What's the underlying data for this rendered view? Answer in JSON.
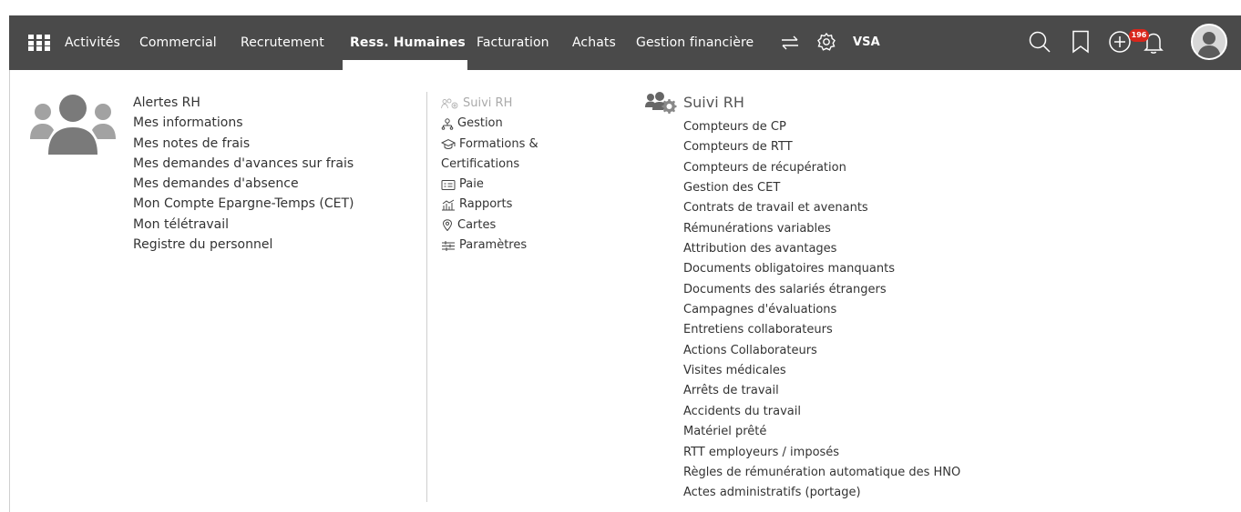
{
  "topnav": {
    "items": [
      "Activités",
      "Commercial",
      "Recrutement",
      "Ress. Humaines",
      "Facturation",
      "Achats",
      "Gestion financière"
    ],
    "active": "Ress. Humaines",
    "vsa_label": "VSA",
    "notifications_count": "196",
    "icons": [
      "apps-grid-icon",
      "swap-arrows-icon",
      "gear-icon",
      "search-icon",
      "bookmark-icon",
      "plus-circle-icon",
      "bell-icon",
      "user-avatar"
    ]
  },
  "personal_menu": {
    "items": [
      "Alertes RH",
      "Mes informations",
      "Mes notes de frais",
      "Mes demandes d'avances sur frais",
      "Mes demandes d'absence",
      "Mon Compte Epargne-Temps (CET)",
      "Mon télétravail",
      "Registre du personnel"
    ]
  },
  "modules_menu": {
    "items": [
      {
        "label": "Suivi RH",
        "icon": "users-gear-icon",
        "muted": true
      },
      {
        "label": "Gestion",
        "icon": "org-chart-icon"
      },
      {
        "label": "Formations &",
        "icon": "graduation-cap-icon"
      },
      {
        "label": "Certifications",
        "icon": ""
      },
      {
        "label": "Paie",
        "icon": "payslip-icon"
      },
      {
        "label": "Rapports",
        "icon": "report-chart-icon"
      },
      {
        "label": "Cartes",
        "icon": "map-pin-icon"
      },
      {
        "label": "Paramètres",
        "icon": "sliders-icon"
      }
    ]
  },
  "suivi_rh": {
    "title": "Suivi RH",
    "items": [
      "Compteurs de CP",
      "Compteurs de RTT",
      "Compteurs de récupération",
      "Gestion des CET",
      "Contrats de travail et avenants",
      "Rémunérations variables",
      "Attribution des avantages",
      "Documents obligatoires manquants",
      "Documents des salariés étrangers",
      "Campagnes d'évaluations",
      "Entretiens collaborateurs",
      "Actions Collaborateurs",
      "Visites médicales",
      "Arrêts de travail",
      "Accidents du travail",
      "Matériel prêté",
      "RTT employeurs / imposés",
      "Règles de rémunération automatique des HNO",
      "Actes administratifs (portage)"
    ]
  },
  "colors": {
    "topbar": "#4a4a4a",
    "text": "#333333",
    "muted": "#aaaaaa",
    "badge": "#d9261c",
    "illustration": "#7a7a7a"
  }
}
